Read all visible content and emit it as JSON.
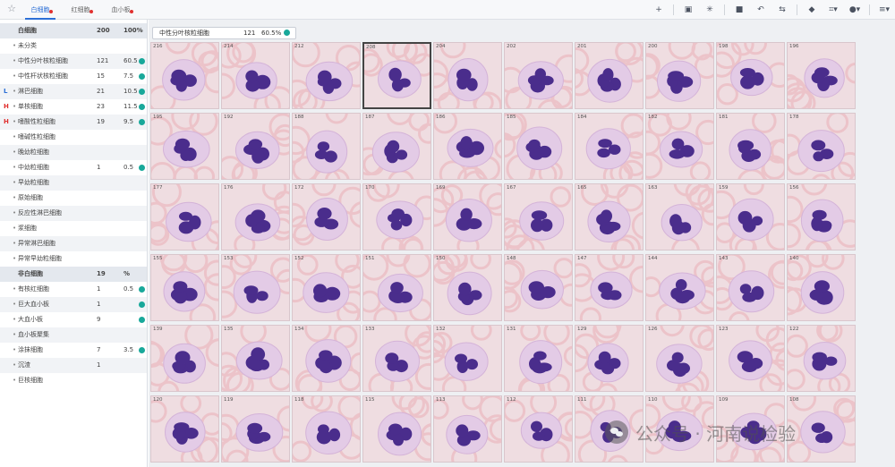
{
  "tabs": [
    {
      "label": "白细胞",
      "active": true,
      "dot": true
    },
    {
      "label": "红细胞",
      "active": false,
      "dot": true
    },
    {
      "label": "血小板",
      "active": false,
      "dot": true
    }
  ],
  "toolbar": [
    {
      "icon": "plus-icon",
      "glyph": "+"
    },
    {
      "icon": "sep"
    },
    {
      "icon": "copy-icon",
      "glyph": "▣"
    },
    {
      "icon": "asterisk-icon",
      "glyph": "✳"
    },
    {
      "icon": "sep"
    },
    {
      "icon": "save-icon",
      "glyph": "■"
    },
    {
      "icon": "undo-icon",
      "glyph": "↶"
    },
    {
      "icon": "image-swap-icon",
      "glyph": "⇆"
    },
    {
      "icon": "sep"
    },
    {
      "icon": "bookmark-icon",
      "glyph": "◆"
    },
    {
      "icon": "crop-icon",
      "glyph": "⌗▾"
    },
    {
      "icon": "palette-icon",
      "glyph": "●▾"
    },
    {
      "icon": "sep"
    },
    {
      "icon": "menu-icon",
      "glyph": "≡▾"
    }
  ],
  "sidebar": {
    "wbc_header": {
      "name": "白细胞",
      "count": "200",
      "pct": "100%"
    },
    "wbc_rows": [
      {
        "flag": "",
        "name": "未分类",
        "count": "",
        "pct": "",
        "mark": false
      },
      {
        "flag": "",
        "name": "中性分叶核粒细胞",
        "count": "121",
        "pct": "60.5",
        "mark": true
      },
      {
        "flag": "",
        "name": "中性杆状核粒细胞",
        "count": "15",
        "pct": "7.5",
        "mark": true
      },
      {
        "flag": "L",
        "name": "淋巴细胞",
        "count": "21",
        "pct": "10.5",
        "mark": true
      },
      {
        "flag": "H",
        "name": "单核细胞",
        "count": "23",
        "pct": "11.5",
        "mark": true
      },
      {
        "flag": "H",
        "name": "嗜酸性粒细胞",
        "count": "19",
        "pct": "9.5",
        "mark": true
      },
      {
        "flag": "",
        "name": "嗜碱性粒细胞",
        "count": "",
        "pct": "",
        "mark": false
      },
      {
        "flag": "",
        "name": "晚幼粒细胞",
        "count": "",
        "pct": "",
        "mark": false
      },
      {
        "flag": "",
        "name": "中幼粒细胞",
        "count": "1",
        "pct": "0.5",
        "mark": true
      },
      {
        "flag": "",
        "name": "早幼粒细胞",
        "count": "",
        "pct": "",
        "mark": false
      },
      {
        "flag": "",
        "name": "原始细胞",
        "count": "",
        "pct": "",
        "mark": false
      },
      {
        "flag": "",
        "name": "反应性淋巴细胞",
        "count": "",
        "pct": "",
        "mark": false
      },
      {
        "flag": "",
        "name": "浆细胞",
        "count": "",
        "pct": "",
        "mark": false
      },
      {
        "flag": "",
        "name": "异常淋巴细胞",
        "count": "",
        "pct": "",
        "mark": false
      },
      {
        "flag": "",
        "name": "异常早幼粒细胞",
        "count": "",
        "pct": "",
        "mark": false
      }
    ],
    "non_wbc_header": {
      "name": "非白细胞",
      "count": "19",
      "pct": "%"
    },
    "non_wbc_rows": [
      {
        "flag": "",
        "name": "有核红细胞",
        "count": "1",
        "pct": "0.5",
        "mark": true
      },
      {
        "flag": "",
        "name": "巨大血小板",
        "count": "1",
        "pct": "",
        "mark": true
      },
      {
        "flag": "",
        "name": "大血小板",
        "count": "9",
        "pct": "",
        "mark": true
      },
      {
        "flag": "",
        "name": "血小板聚集",
        "count": "",
        "pct": "",
        "mark": false
      },
      {
        "flag": "",
        "name": "涂抹细胞",
        "count": "7",
        "pct": "3.5",
        "mark": true
      },
      {
        "flag": "",
        "name": "沉渣",
        "count": "1",
        "pct": "",
        "mark": false
      },
      {
        "flag": "",
        "name": "巨核细胞",
        "count": "",
        "pct": "",
        "mark": false
      }
    ]
  },
  "selected_class": {
    "name": "中性分叶核粒细胞",
    "count": "121",
    "pct": "60.5%"
  },
  "cells": [
    "216",
    "214",
    "212",
    "208",
    "204",
    "202",
    "201",
    "200",
    "198",
    "196",
    "195",
    "192",
    "188",
    "187",
    "186",
    "185",
    "184",
    "182",
    "181",
    "178",
    "177",
    "176",
    "172",
    "170",
    "169",
    "167",
    "165",
    "163",
    "159",
    "156",
    "155",
    "153",
    "152",
    "151",
    "150",
    "148",
    "147",
    "144",
    "143",
    "140",
    "139",
    "135",
    "134",
    "133",
    "132",
    "131",
    "129",
    "126",
    "123",
    "122",
    "120",
    "119",
    "118",
    "115",
    "113",
    "112",
    "111",
    "110",
    "109",
    "108"
  ],
  "selected_cell": "208",
  "watermark": {
    "text": "公众号 · 河南说检验"
  },
  "colors": {
    "accent": "#2c6fd6",
    "mark": "#18a89a",
    "high": "#e0302f",
    "low": "#2c6fd6",
    "nucleus": "#4a2d8c",
    "cytoplasm": "#e3cbe6",
    "rbc": "#ecc3c9"
  }
}
